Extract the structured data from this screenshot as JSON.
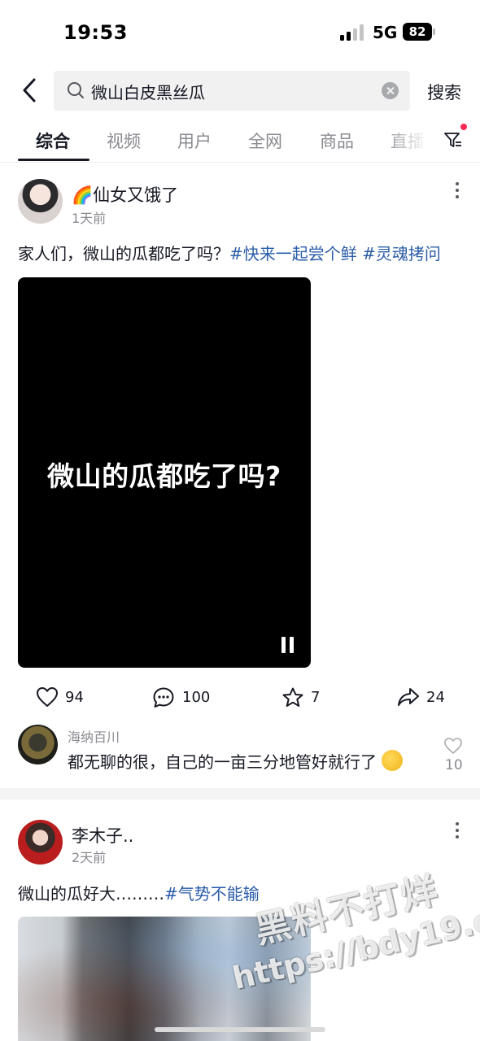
{
  "status_bar": {
    "time": "19:53",
    "network": "5G",
    "battery": "82"
  },
  "search": {
    "query": "微山白皮黑丝瓜",
    "submit_label": "搜索"
  },
  "tabs": [
    {
      "label": "综合",
      "active": true
    },
    {
      "label": "视频"
    },
    {
      "label": "用户"
    },
    {
      "label": "全网"
    },
    {
      "label": "商品"
    },
    {
      "label": "直播"
    }
  ],
  "posts": [
    {
      "username": "🌈仙女又饿了",
      "time": "1天前",
      "text": "家人们，微山的瓜都吃了吗？",
      "hashtags": [
        "#快来一起尝个鲜",
        "#灵魂拷问"
      ],
      "video_caption": "微山的瓜都吃了吗?",
      "likes": "94",
      "comments": "100",
      "favorites": "7",
      "shares": "24",
      "top_comment": {
        "user": "海纳百川",
        "text": "都无聊的很，自己的一亩三分地管好就行了",
        "likes": "10"
      }
    },
    {
      "username": "李木子..",
      "time": "2天前",
      "text": "微山的瓜好大………",
      "hashtags": [
        "#气势不能输"
      ]
    }
  ],
  "watermark": {
    "line1": "黑料不打烊",
    "line2": "https://bdy19.co"
  },
  "colors": {
    "hashtag": "#2a5ca8",
    "accent_dot": "#fe2c55",
    "text": "#161823",
    "muted": "#8a8b91"
  }
}
